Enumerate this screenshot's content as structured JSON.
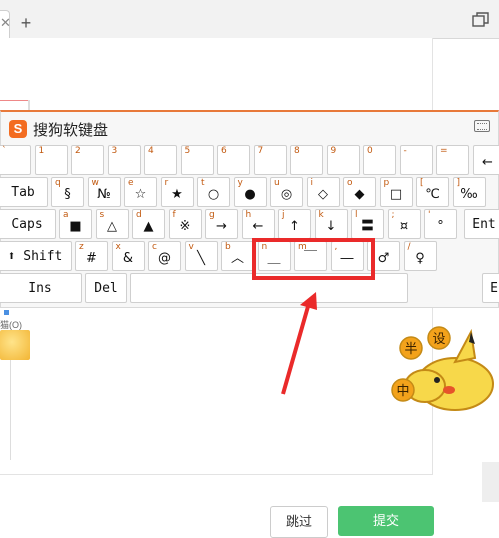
{
  "browser": {
    "new_tab": "+"
  },
  "keyboard": {
    "title": "搜狗软键盘",
    "row1": [
      {
        "top": "`",
        "main": ""
      },
      {
        "top": "1",
        "main": ""
      },
      {
        "top": "2",
        "main": ""
      },
      {
        "top": "3",
        "main": ""
      },
      {
        "top": "4",
        "main": ""
      },
      {
        "top": "5",
        "main": ""
      },
      {
        "top": "6",
        "main": ""
      },
      {
        "top": "7",
        "main": ""
      },
      {
        "top": "8",
        "main": ""
      },
      {
        "top": "9",
        "main": ""
      },
      {
        "top": "0",
        "main": ""
      },
      {
        "top": "-",
        "main": ""
      },
      {
        "top": "=",
        "main": ""
      },
      {
        "top": "",
        "main": "←"
      }
    ],
    "row2_label": "Tab",
    "row2": [
      {
        "top": "q",
        "main": "§"
      },
      {
        "top": "w",
        "main": "№"
      },
      {
        "top": "e",
        "main": "☆"
      },
      {
        "top": "r",
        "main": "★"
      },
      {
        "top": "t",
        "main": "○"
      },
      {
        "top": "y",
        "main": "●"
      },
      {
        "top": "u",
        "main": "◎"
      },
      {
        "top": "i",
        "main": "◇"
      },
      {
        "top": "o",
        "main": "◆"
      },
      {
        "top": "p",
        "main": "□"
      },
      {
        "top": "[",
        "main": "℃"
      },
      {
        "top": "]",
        "main": "‰"
      }
    ],
    "row3_label": "Caps",
    "row3": [
      {
        "top": "a",
        "main": "■"
      },
      {
        "top": "s",
        "main": "△"
      },
      {
        "top": "d",
        "main": "▲"
      },
      {
        "top": "f",
        "main": "※"
      },
      {
        "top": "g",
        "main": "→"
      },
      {
        "top": "h",
        "main": "←"
      },
      {
        "top": "j",
        "main": "↑"
      },
      {
        "top": "k",
        "main": "↓"
      },
      {
        "top": "l",
        "main": "〓"
      },
      {
        "top": ";",
        "main": "¤"
      },
      {
        "top": "'",
        "main": "°"
      }
    ],
    "row3_end": "Ent",
    "row4_label": "⬆ Shift",
    "row4": [
      {
        "top": "z",
        "main": "#"
      },
      {
        "top": "x",
        "main": "&"
      },
      {
        "top": "c",
        "main": "@"
      },
      {
        "top": "v",
        "main": "╲"
      },
      {
        "top": "b",
        "main": "︿"
      },
      {
        "top": "n",
        "main": "＿"
      },
      {
        "top": "m",
        "main": "￣"
      },
      {
        "top": ",",
        "main": "―"
      },
      {
        "top": ".",
        "main": "♂"
      },
      {
        "top": "/",
        "main": "♀"
      }
    ],
    "row5": {
      "ins": "Ins",
      "del": "Del",
      "right": "E"
    }
  },
  "page": {
    "skip_button": "跳过",
    "submit_button": "提交",
    "thumb_label": "猫(O)"
  },
  "sticker": {
    "chars": [
      "半",
      "设",
      "中"
    ]
  },
  "colors": {
    "accent": "#e8793a",
    "highlight": "#ea2a2a",
    "submit": "#4cc472"
  }
}
